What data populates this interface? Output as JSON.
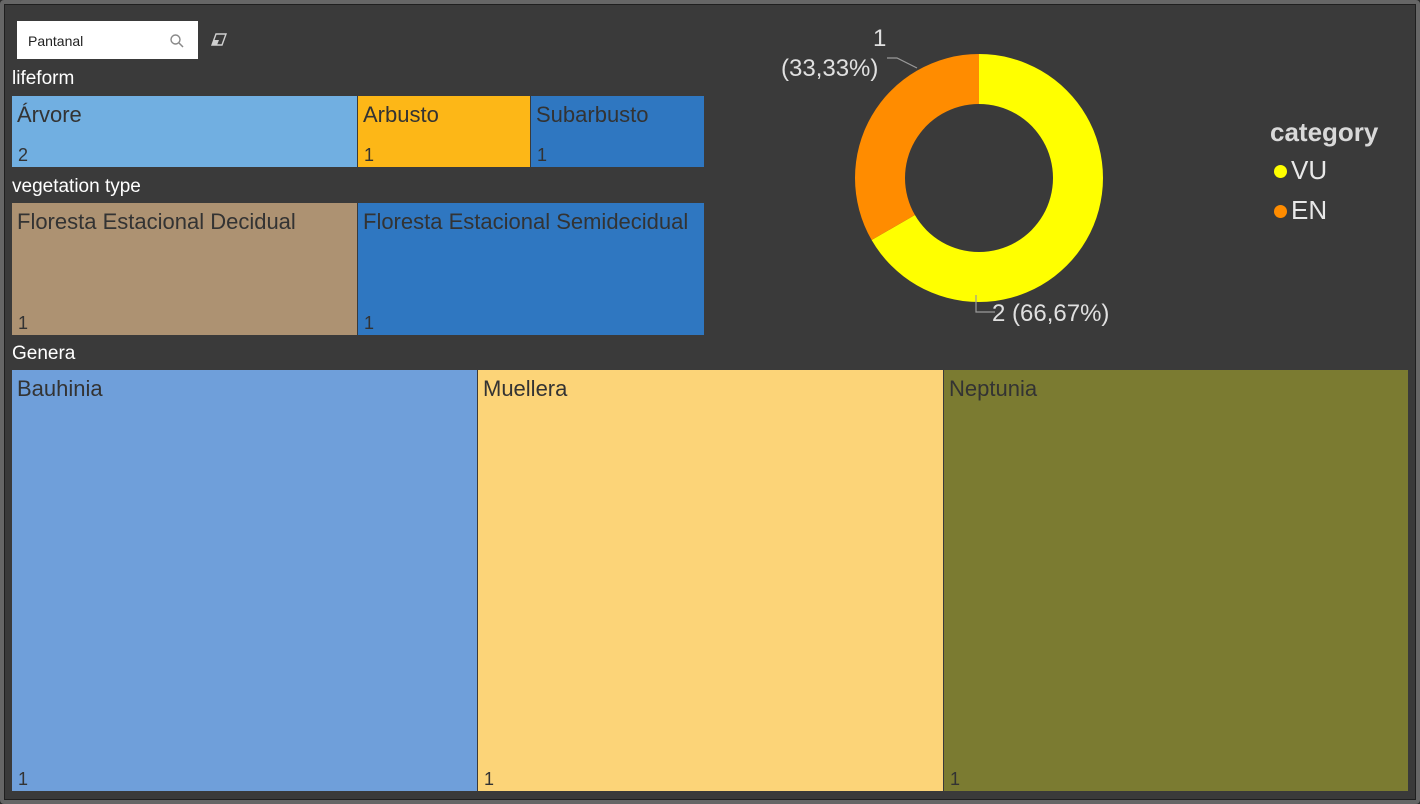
{
  "slicer": {
    "search_text": "Pantanal"
  },
  "lifeform": {
    "title": "lifeform",
    "tiles": [
      {
        "label": "Árvore",
        "count": "2",
        "color": "#71afe1"
      },
      {
        "label": "Arbusto",
        "count": "1",
        "color": "#fdb717"
      },
      {
        "label": "Subarbusto",
        "count": "1",
        "color": "#2f77c1"
      }
    ]
  },
  "vegetation": {
    "title": "vegetation type",
    "tiles": [
      {
        "label": "Floresta Estacional Decidual",
        "count": "1",
        "color": "#ad9272"
      },
      {
        "label": "Floresta Estacional Semidecidual",
        "count": "1",
        "color": "#2f77c1"
      }
    ]
  },
  "genera": {
    "title": "Genera",
    "tiles": [
      {
        "label": "Bauhinia",
        "count": "1",
        "color": "#6f9fda"
      },
      {
        "label": "Muellera",
        "count": "1",
        "color": "#fcd478"
      },
      {
        "label": "Neptunia",
        "count": "1",
        "color": "#7b7b31"
      }
    ]
  },
  "chart_data": {
    "type": "pie",
    "donut": true,
    "categories": [
      "VU",
      "EN"
    ],
    "values": [
      2,
      1
    ],
    "colors": [
      "#ffff00",
      "#ff8c00"
    ],
    "data_labels": [
      {
        "value": "2",
        "percent": "(66,67%)"
      },
      {
        "value": "1",
        "percent": "(33,33%)"
      }
    ],
    "legend_title": "category",
    "legend_position": "right"
  }
}
